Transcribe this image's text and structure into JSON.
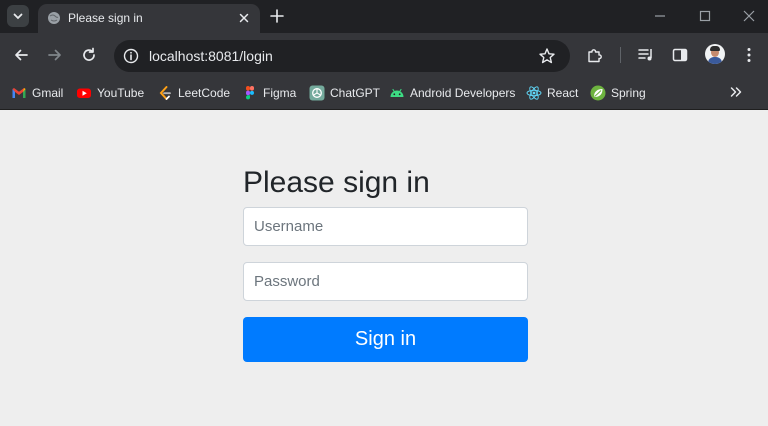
{
  "browser": {
    "tab_title": "Please sign in",
    "url": "localhost:8081/login"
  },
  "bookmarks": [
    {
      "label": "Gmail",
      "icon": "gmail-icon"
    },
    {
      "label": "YouTube",
      "icon": "youtube-icon"
    },
    {
      "label": "LeetCode",
      "icon": "leetcode-icon"
    },
    {
      "label": "Figma",
      "icon": "figma-icon"
    },
    {
      "label": "ChatGPT",
      "icon": "chatgpt-icon"
    },
    {
      "label": "Android Developers",
      "icon": "android-icon"
    },
    {
      "label": "React",
      "icon": "react-icon"
    },
    {
      "label": "Spring",
      "icon": "spring-icon"
    }
  ],
  "login": {
    "heading": "Please sign in",
    "username_placeholder": "Username",
    "password_placeholder": "Password",
    "submit_label": "Sign in"
  },
  "colors": {
    "primary": "#007bff",
    "page_background": "#eeeeee",
    "browser_dark": "#202124",
    "toolbar": "#35363a"
  }
}
